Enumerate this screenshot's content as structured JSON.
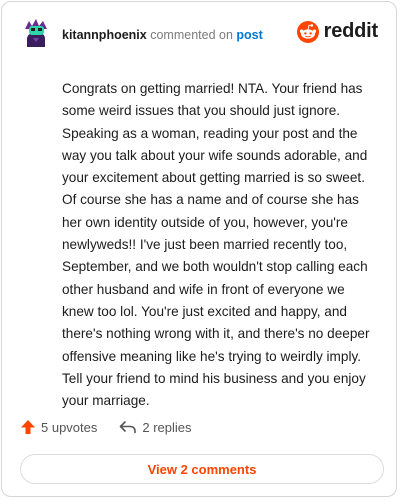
{
  "header": {
    "username": "kitannphoenix",
    "action": "commented on",
    "post_link": "post"
  },
  "brand": {
    "wordmark": "reddit",
    "logo_icon": "reddit-alien-icon",
    "color": "#ff4500"
  },
  "comment": {
    "body": "Congrats on getting married! NTA. Your friend has some weird issues that you should just ignore. Speaking as a woman, reading your post and the way you talk about your wife sounds adorable, and your excitement about getting married is so sweet. Of course she has a name and of course she has her own identity outside of you, however, you're newlyweds!! I've just been married recently too, September, and we both wouldn't stop calling each other husband and wife in front of everyone we knew too lol. You're just excited and happy, and there's nothing wrong with it, and there's no deeper offensive meaning like he's trying to weirdly imply. Tell your friend to mind his business and you enjoy your marriage."
  },
  "footer": {
    "upvotes": "5 upvotes",
    "replies": "2 replies",
    "upvote_icon": "upvote-arrow-icon",
    "reply_icon": "reply-arrow-icon"
  },
  "view_comments": "View 2 comments"
}
